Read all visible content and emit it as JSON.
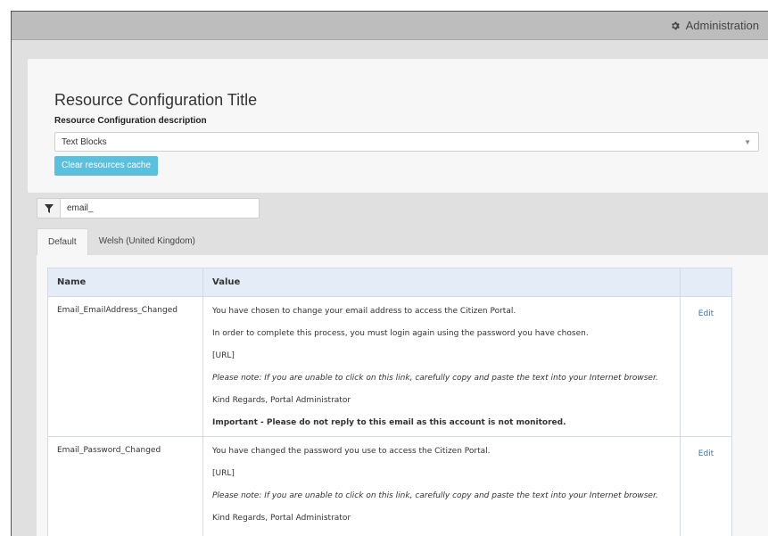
{
  "header": {
    "admin_label": "Administration"
  },
  "config": {
    "title": "Resource Configuration Title",
    "description": "Resource Configuration description",
    "select_value": "Text Blocks",
    "clear_button": "Clear resources cache"
  },
  "filter": {
    "value": "email_"
  },
  "tabs": [
    {
      "label": "Default",
      "active": true
    },
    {
      "label": "Welsh (United Kingdom)",
      "active": false
    }
  ],
  "table": {
    "headers": {
      "name": "Name",
      "value": "Value",
      "action": ""
    },
    "rows": [
      {
        "name": "Email_EmailAddress_Changed",
        "edit": "Edit",
        "lines": [
          {
            "text": "You have chosen to change your email address to access the Citizen Portal.",
            "style": "normal"
          },
          {
            "text": "In order to complete this process, you must login again using the password you have chosen.",
            "style": "normal"
          },
          {
            "text": "[URL]",
            "style": "normal"
          },
          {
            "text": "Please note: If you are unable to click on this link, carefully copy and paste the text into your Internet browser.",
            "style": "italic"
          },
          {
            "text": "Kind Regards, Portal Administrator",
            "style": "normal"
          },
          {
            "text": "Important - Please do not reply to this email as this account is not monitored.",
            "style": "bold"
          }
        ]
      },
      {
        "name": "Email_Password_Changed",
        "edit": "Edit",
        "lines": [
          {
            "text": "You have changed the password you use to access the Citizen Portal.",
            "style": "normal"
          },
          {
            "text": "[URL]",
            "style": "normal"
          },
          {
            "text": "Please note: If you are unable to click on this link, carefully copy and paste the text into your Internet browser.",
            "style": "italic"
          },
          {
            "text": "Kind Regards, Portal Administrator",
            "style": "normal"
          }
        ]
      }
    ]
  },
  "colors": {
    "accent": "#5bc0de",
    "link": "#337ab7",
    "table_header": "#e4edf7"
  }
}
